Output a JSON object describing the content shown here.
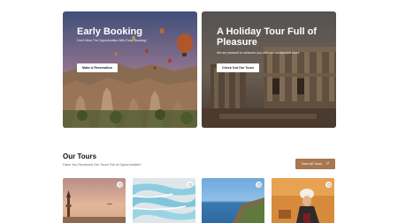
{
  "hero": {
    "left": {
      "title": "Early Booking",
      "subtitle": "Don't Miss The Opportunities With Early Booking!",
      "button": "Make A Reservation"
    },
    "right": {
      "title": "A Holiday Tour Full of Pleasure",
      "subtitle": "We are pleased to welcome you with our comfortable tours",
      "button": "Check Out Our Tours"
    }
  },
  "tours": {
    "title": "Our Tours",
    "subtitle": "Have You Reviewed Our Tours Full of Opportunities?",
    "view_all": "View All Tours",
    "view_all_icon": "arrow-up-right-icon",
    "favorite_icon": "heart-icon",
    "cards": [
      {
        "name": "tour-card-galata"
      },
      {
        "name": "tour-card-pamukkale"
      },
      {
        "name": "tour-card-coast"
      },
      {
        "name": "tour-card-painting"
      }
    ]
  },
  "colors": {
    "accent": "#a8764f",
    "text_dark": "#111111",
    "text_muted": "#666666"
  }
}
